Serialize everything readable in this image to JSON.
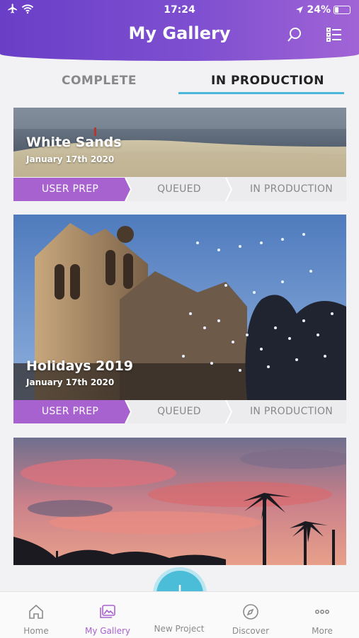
{
  "status_bar": {
    "time": "17:24",
    "battery": "24%",
    "icons": [
      "airplane-icon",
      "wifi-icon",
      "location-arrow-icon",
      "battery-icon"
    ]
  },
  "header": {
    "title": "My Gallery",
    "search_icon": "search-icon",
    "list_icon": "list-icon"
  },
  "tabs": [
    {
      "label": "COMPLETE",
      "active": false
    },
    {
      "label": "IN PRODUCTION",
      "active": true
    }
  ],
  "cards": [
    {
      "title": "White Sands",
      "date": "January 17th 2020",
      "steps": [
        "USER PREP",
        "QUEUED",
        "IN PRODUCTION"
      ],
      "active_step": 0
    },
    {
      "title": "Holidays 2019",
      "date": "January 17th 2020",
      "steps": [
        "USER PREP",
        "QUEUED",
        "IN PRODUCTION"
      ],
      "active_step": 0
    },
    {
      "title": "",
      "date": ""
    }
  ],
  "tab_bar": {
    "items": [
      {
        "label": "Home",
        "icon": "home-icon",
        "active": false
      },
      {
        "label": "My Gallery",
        "icon": "gallery-icon",
        "active": true
      },
      {
        "label": "New Project",
        "icon": "plus-icon",
        "active": false
      },
      {
        "label": "Discover",
        "icon": "compass-icon",
        "active": false
      },
      {
        "label": "More",
        "icon": "more-icon",
        "active": false
      }
    ]
  },
  "colors": {
    "header_gradient_start": "#6a3fc7",
    "header_gradient_end": "#a164d6",
    "accent_purple": "#a862d0",
    "accent_cyan": "#4bbdd8"
  }
}
